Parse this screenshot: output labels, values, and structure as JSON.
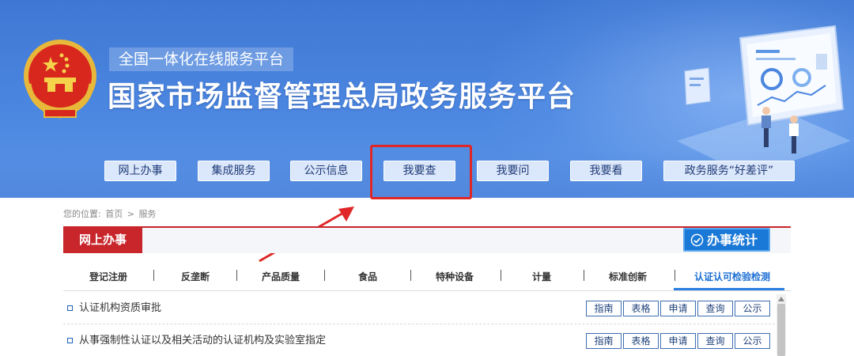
{
  "header": {
    "subtitle": "全国一体化在线服务平台",
    "title": "国家市场监督管理总局政务服务平台"
  },
  "nav": [
    {
      "label": "网上办事"
    },
    {
      "label": "集成服务"
    },
    {
      "label": "公示信息"
    },
    {
      "label": "我要查"
    },
    {
      "label": "我要问"
    },
    {
      "label": "我要看"
    },
    {
      "label": "政务服务“好差评”"
    }
  ],
  "breadcrumb": {
    "prefix": "您的位置:",
    "home": "首页",
    "sep": ">",
    "current": "服务"
  },
  "section": {
    "title": "网上办事",
    "stats_button": "办事统计"
  },
  "tabs": [
    {
      "label": "登记注册"
    },
    {
      "label": "反垄断"
    },
    {
      "label": "产品质量"
    },
    {
      "label": "食品"
    },
    {
      "label": "特种设备"
    },
    {
      "label": "计量"
    },
    {
      "label": "标准创新"
    },
    {
      "label": "认证认可检验检测",
      "active": true
    }
  ],
  "rows": [
    {
      "name": "认证机构资质审批",
      "actions": [
        "指南",
        "表格",
        "申请",
        "查询",
        "公示"
      ]
    },
    {
      "name": "从事强制性认证以及相关活动的认证机构及实验室指定",
      "actions": [
        "指南",
        "表格",
        "申请",
        "查询",
        "公示"
      ]
    }
  ],
  "colors": {
    "banner_blue": "#4b86e0",
    "accent_red": "#c8262b",
    "stats_blue": "#1a78d6",
    "highlight_red": "#e02727"
  },
  "icons": [
    "national-emblem",
    "check-circle-icon",
    "arrow-annotation",
    "dashboard-illustration"
  ]
}
